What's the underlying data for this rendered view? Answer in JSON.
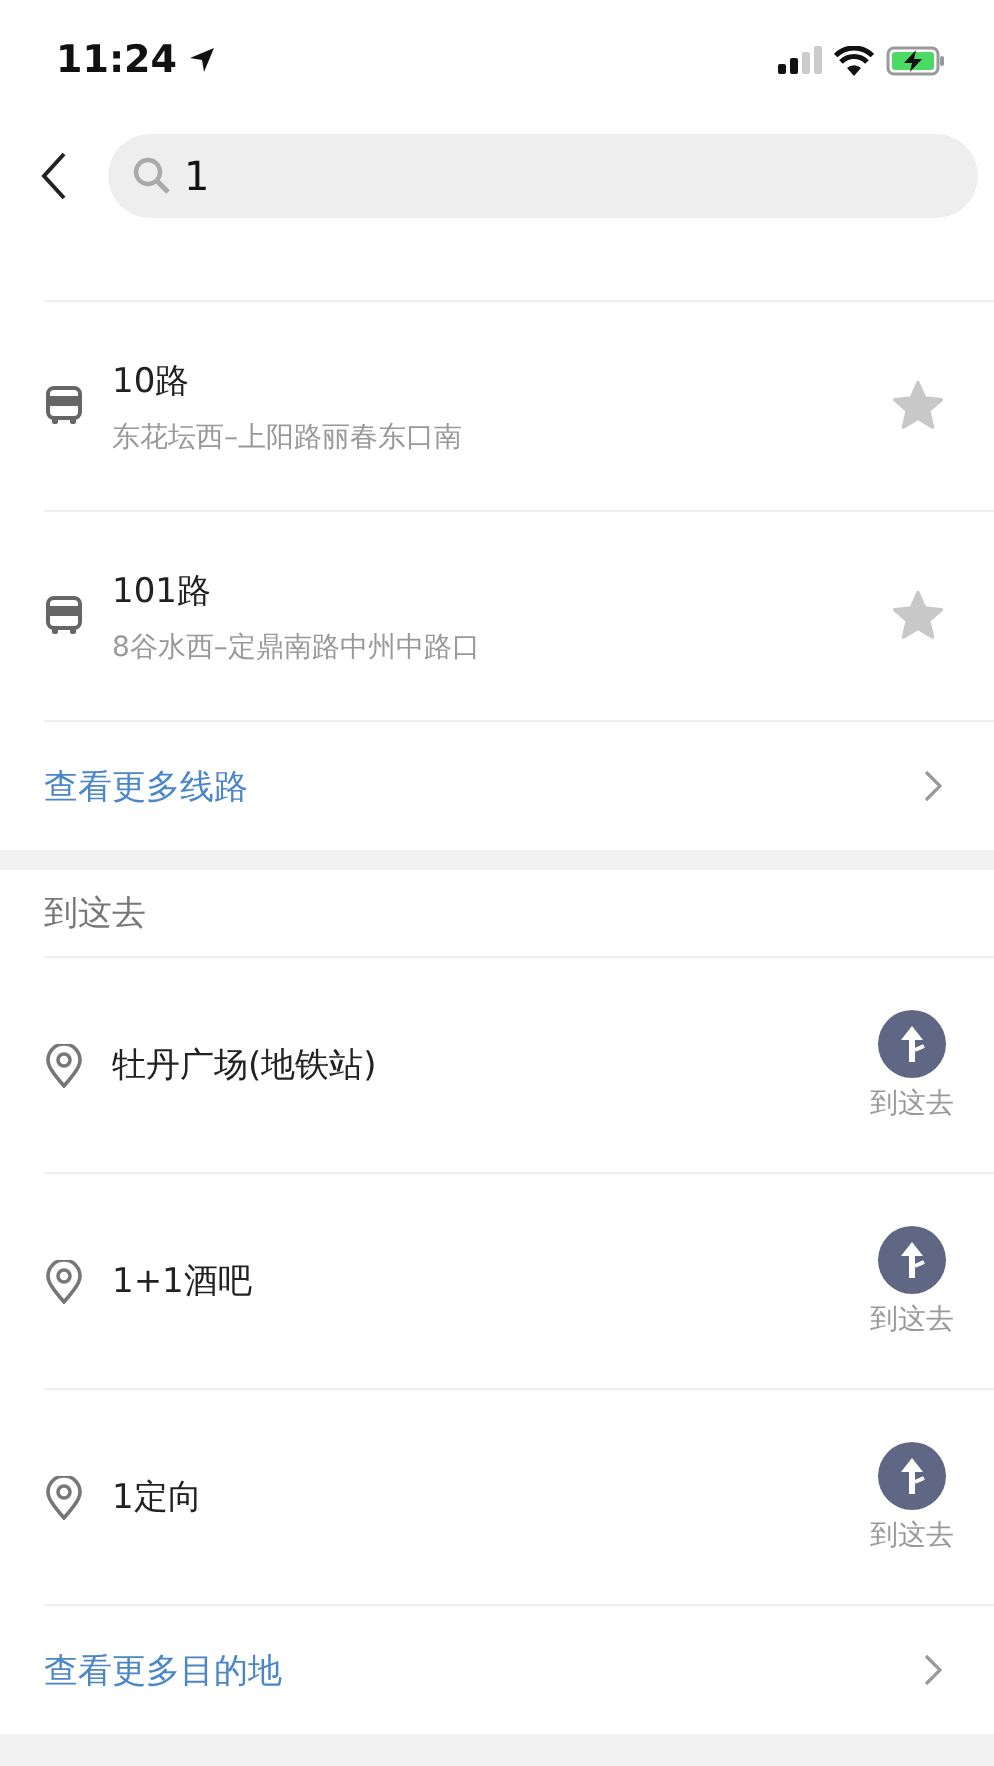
{
  "status_bar": {
    "time": "11:24"
  },
  "search": {
    "value": "1"
  },
  "routes": [
    {
      "name": "10路",
      "stops": "东花坛西–上阳路丽春东口南",
      "favorite": false
    },
    {
      "name": "101路",
      "stops": "8谷水西–定鼎南路中州中路口",
      "favorite": false
    }
  ],
  "more_routes": "查看更多线路",
  "places_section": {
    "title": "到这去",
    "items": [
      {
        "name": "牡丹广场(地铁站)",
        "action": "到这去"
      },
      {
        "name": "1+1酒吧",
        "action": "到这去"
      },
      {
        "name": "1定向",
        "action": "到这去"
      }
    ],
    "more": "查看更多目的地"
  }
}
